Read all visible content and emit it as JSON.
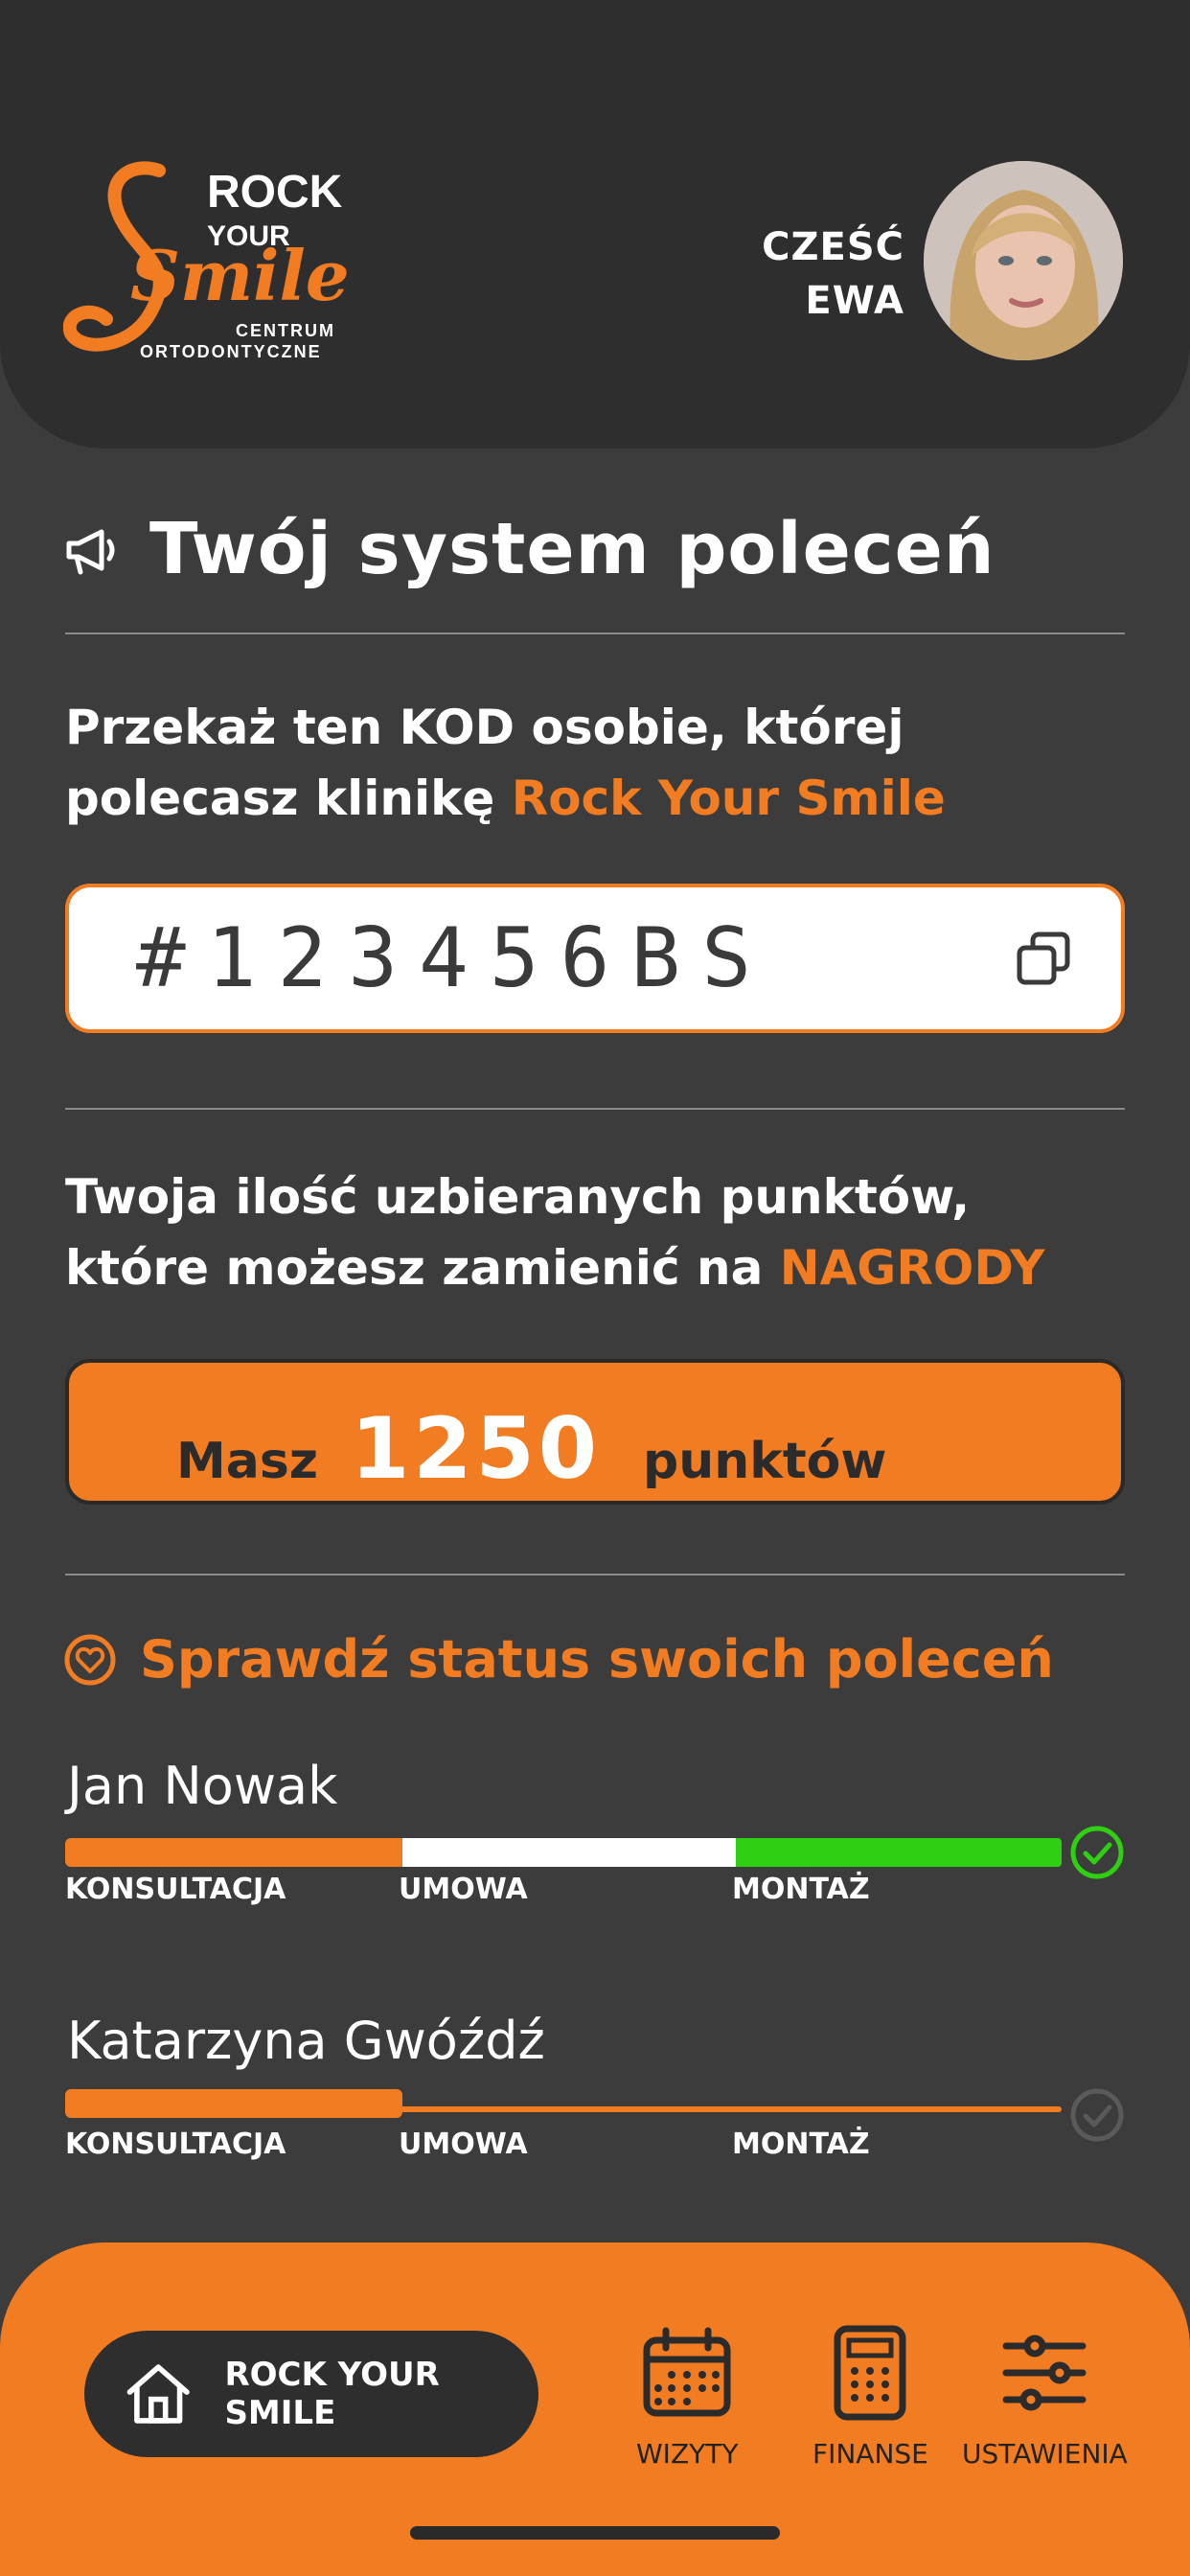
{
  "header": {
    "logo": {
      "line1": "ROCK",
      "line2": "YOUR",
      "script": "Smile",
      "sub1": "CENTRUM",
      "sub2": "ORTODONTYCZNE"
    },
    "greeting_line1": "CZEŚĆ",
    "greeting_line2": "EWA"
  },
  "referral": {
    "title": "Twój system poleceń",
    "instruction_text": "Przekaż ten KOD osobie, której polecasz klinikę ",
    "instruction_accent": "Rock Your Smile",
    "code": "#123456BS",
    "points_intro_text": "Twoja ilość uzbieranych punktów, które możesz zamienić na ",
    "points_intro_accent": "NAGRODY",
    "points_prefix": "Masz",
    "points_value": "1250",
    "points_suffix": "punktów",
    "status_title": "Sprawdź status swoich poleceń"
  },
  "referrals": [
    {
      "name": "Jan Nowak",
      "stages": [
        "KONSULTACJA",
        "UMOWA",
        "MONTAŻ"
      ],
      "completed_stages": 3
    },
    {
      "name": "Katarzyna Gwóźdź",
      "stages": [
        "KONSULTACJA",
        "UMOWA",
        "MONTAŻ"
      ],
      "completed_stages": 1
    }
  ],
  "nav": {
    "home_label": "ROCK YOUR SMILE",
    "visits_label": "WIZYTY",
    "finance_label": "FINANSE",
    "settings_label": "USTAWIENIA"
  },
  "colors": {
    "accent": "#f27c22",
    "background": "#3c3c3c",
    "header": "#2e2e2e",
    "success": "#2fd012"
  }
}
